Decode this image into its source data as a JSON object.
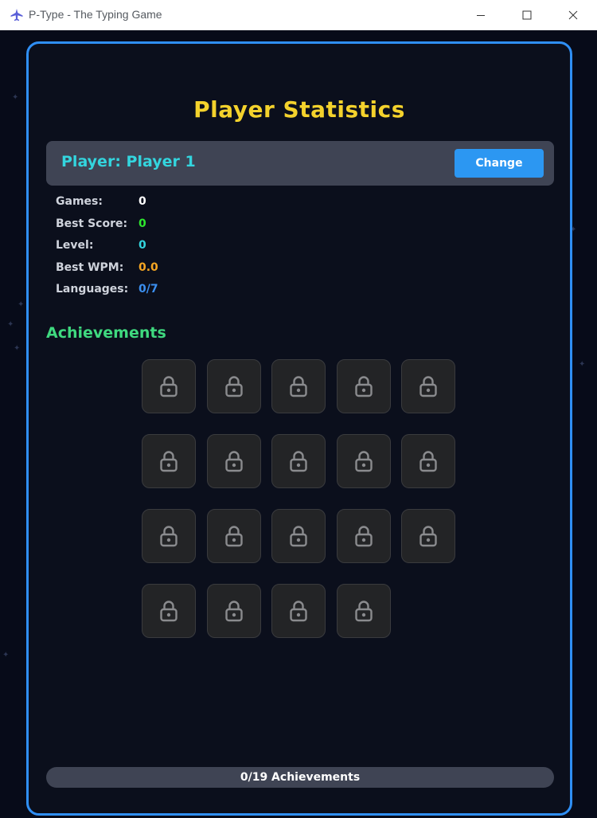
{
  "window": {
    "title": "P-Type - The Typing Game",
    "icon": "airplane-icon"
  },
  "screen": {
    "title": "Player Statistics",
    "player_label": "Player: Player 1",
    "change_label": "Change"
  },
  "stats": [
    {
      "label": "Games:",
      "value": "0",
      "color": "#ffffff"
    },
    {
      "label": "Best Score:",
      "value": "0",
      "color": "#2ee82e"
    },
    {
      "label": "Level:",
      "value": "0",
      "color": "#33d5de"
    },
    {
      "label": "Best WPM:",
      "value": "0.0",
      "color": "#f5a623"
    },
    {
      "label": "Languages:",
      "value": "0/7",
      "color": "#3b8ff0"
    }
  ],
  "achievements": {
    "heading": "Achievements",
    "total": 19,
    "unlocked": 0,
    "tile_icon": "lock-icon",
    "progress_text": "0/19 Achievements"
  },
  "colors": {
    "accent": "#2f8ff5",
    "title": "#f4d22c",
    "player": "#33d5de",
    "achievements_heading": "#3fd97f"
  }
}
